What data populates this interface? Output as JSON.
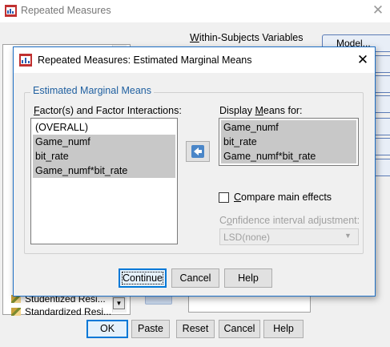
{
  "parent": {
    "title": "Repeated Measures",
    "within_subjects_label": "Within-Subjects Variables",
    "model_button": "Model...",
    "list_items": [
      "Studentized Resi...",
      "Standardized Resi..."
    ],
    "buttons": {
      "ok": "OK",
      "paste": "Paste",
      "reset": "Reset",
      "cancel": "Cancel",
      "help": "Help"
    }
  },
  "modal": {
    "title": "Repeated Measures: Estimated Marginal Means",
    "group_title": "Estimated Marginal Means",
    "factors_label": "Factor(s) and Factor Interactions:",
    "factors": [
      {
        "label": "(OVERALL)",
        "selected": false
      },
      {
        "label": "Game_numf",
        "selected": true
      },
      {
        "label": "bit_rate",
        "selected": true
      },
      {
        "label": "Game_numf*bit_rate",
        "selected": true
      }
    ],
    "display_label": "Display Means for:",
    "display_items": [
      "Game_numf",
      "bit_rate",
      "Game_numf*bit_rate"
    ],
    "compare_main_effects": {
      "label": "Compare main effects",
      "checked": false
    },
    "ci_label": "Confidence interval adjustment:",
    "ci_value": "LSD(none)",
    "buttons": {
      "continue": "Continue",
      "cancel": "Cancel",
      "help": "Help"
    }
  }
}
